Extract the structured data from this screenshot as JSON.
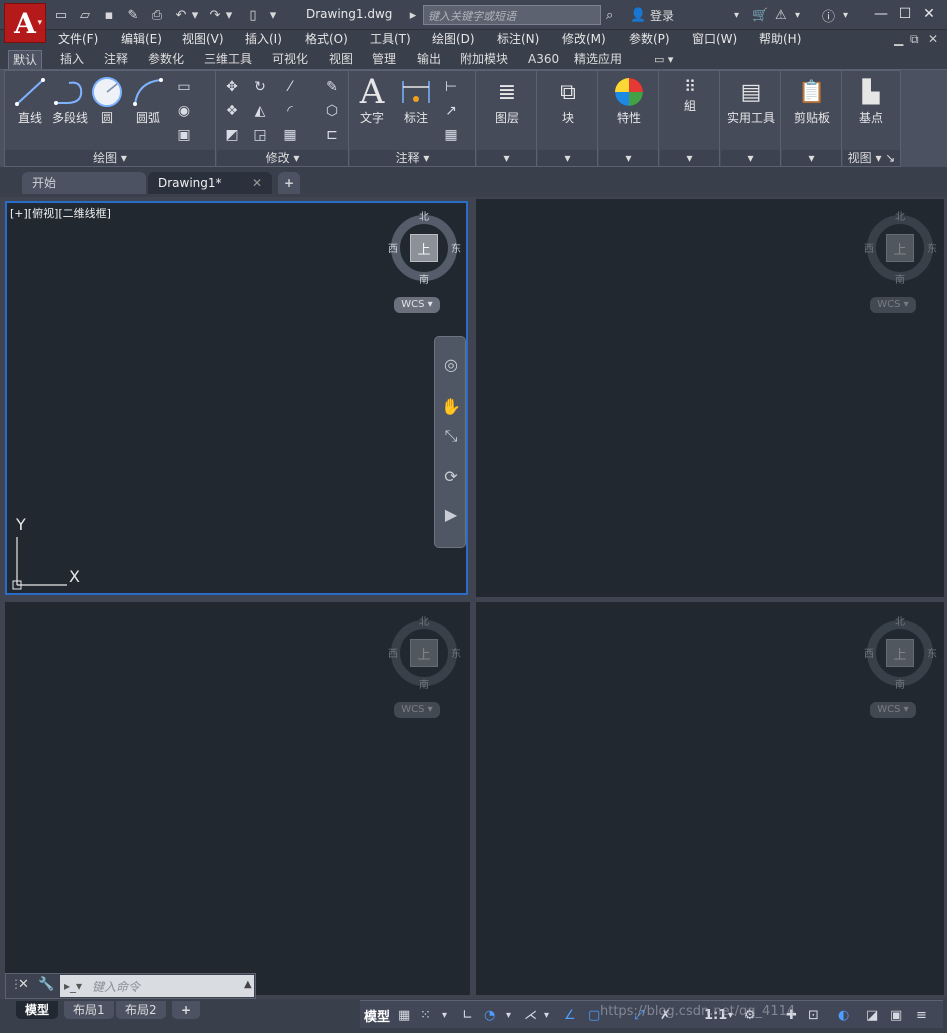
{
  "titlebar": {
    "document": "Drawing1.dwg",
    "search_placeholder": "键入关键字或短语",
    "login": "登录"
  },
  "menu": [
    "文件(F)",
    "编辑(E)",
    "视图(V)",
    "插入(I)",
    "格式(O)",
    "工具(T)",
    "绘图(D)",
    "标注(N)",
    "修改(M)",
    "参数(P)",
    "窗口(W)",
    "帮助(H)"
  ],
  "ribbon_tabs": [
    "默认",
    "插入",
    "注释",
    "参数化",
    "三维工具",
    "可视化",
    "视图",
    "管理",
    "输出",
    "附加模块",
    "A360",
    "精选应用"
  ],
  "ribbon": {
    "draw": {
      "title": "绘图",
      "line": "直线",
      "polyline": "多段线",
      "circle": "圆",
      "arc": "圆弧"
    },
    "modify": {
      "title": "修改"
    },
    "annotation": {
      "title": "注释",
      "text": "文字",
      "dimension": "标注"
    },
    "layers": "图层",
    "block": "块",
    "properties": "特性",
    "groups": "組",
    "utilities": "实用工具",
    "clipboard": "剪贴板",
    "view": {
      "title": "视图",
      "base": "基点"
    }
  },
  "doc_tabs": [
    "开始",
    "Drawing1*"
  ],
  "viewport": {
    "label": "[+][俯视][二维线框]",
    "compass": {
      "north": "北",
      "south": "南",
      "west": "西",
      "east": "东",
      "top": "上",
      "wcs": "WCS"
    },
    "ucs_x": "X",
    "ucs_y": "Y"
  },
  "command": {
    "placeholder": "键入命令"
  },
  "layout_tabs": [
    "模型",
    "布局1",
    "布局2"
  ],
  "status": {
    "model": "模型",
    "scale": "1:1"
  },
  "watermark": "https://blog.csdn.net/qq_4114"
}
